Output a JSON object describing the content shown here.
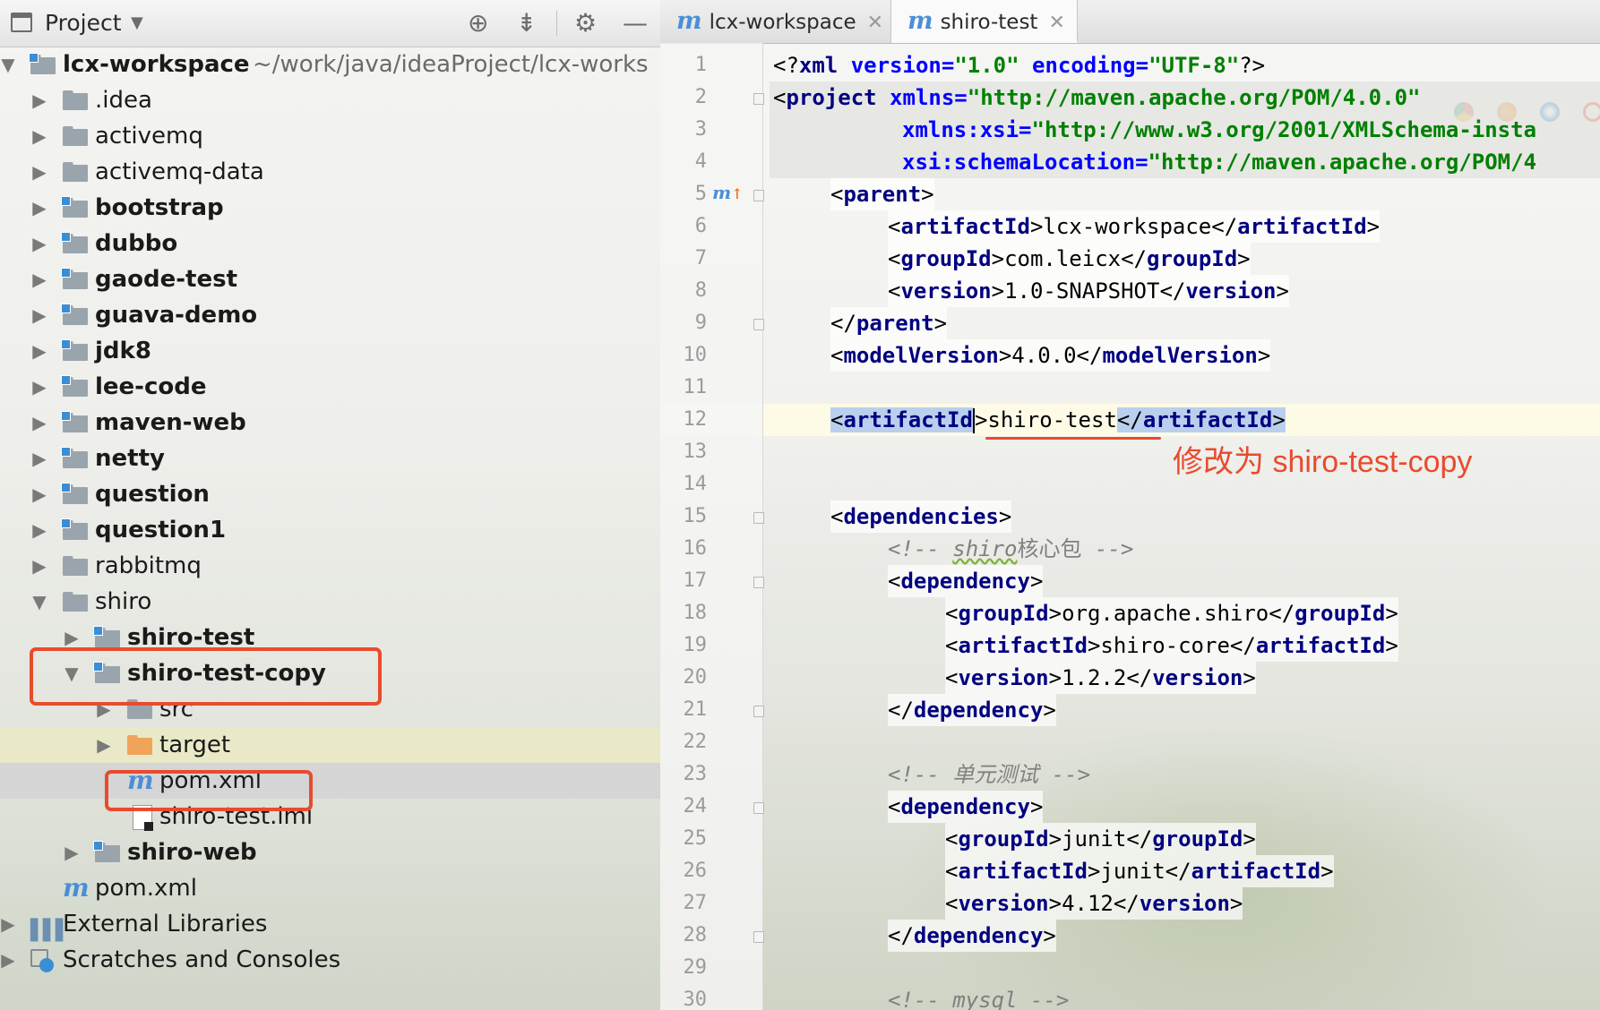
{
  "project_panel": {
    "title": "Project",
    "tree": [
      {
        "label": "lcx-workspace",
        "path": "~/work/java/ideaProject/lcx-works",
        "expanded": true,
        "bold": true
      },
      {
        "label": ".idea"
      },
      {
        "label": "activemq"
      },
      {
        "label": "activemq-data"
      },
      {
        "label": "bootstrap",
        "bold": true
      },
      {
        "label": "dubbo",
        "bold": true
      },
      {
        "label": "gaode-test",
        "bold": true
      },
      {
        "label": "guava-demo",
        "bold": true
      },
      {
        "label": "jdk8",
        "bold": true
      },
      {
        "label": "lee-code",
        "bold": true
      },
      {
        "label": "maven-web",
        "bold": true
      },
      {
        "label": "netty",
        "bold": true
      },
      {
        "label": "question",
        "bold": true
      },
      {
        "label": "question1",
        "bold": true
      },
      {
        "label": "rabbitmq"
      },
      {
        "label": "shiro",
        "expanded": true
      },
      {
        "label": "shiro-test",
        "bold": true
      },
      {
        "label": "shiro-test-copy",
        "bold": true,
        "expanded": true
      },
      {
        "label": "src"
      },
      {
        "label": "target"
      },
      {
        "label": "pom.xml"
      },
      {
        "label": "shiro-test.iml"
      },
      {
        "label": "shiro-web",
        "bold": true
      },
      {
        "label": "pom.xml"
      },
      {
        "label": "External Libraries"
      },
      {
        "label": "Scratches and Consoles"
      }
    ]
  },
  "editor": {
    "tabs": [
      {
        "label": "lcx-workspace",
        "active": false
      },
      {
        "label": "shiro-test",
        "active": true
      }
    ],
    "line_numbers": [
      "1",
      "2",
      "3",
      "4",
      "5",
      "6",
      "7",
      "8",
      "9",
      "10",
      "11",
      "12",
      "13",
      "14",
      "15",
      "16",
      "17",
      "18",
      "19",
      "20",
      "21",
      "22",
      "23",
      "24",
      "25",
      "26",
      "27",
      "28",
      "29",
      "30"
    ],
    "lines": {
      "l1": {
        "a": "<?",
        "b": "xml ",
        "c": "version",
        "d": "=",
        "e": "\"1.0\"",
        "f": " encoding",
        "g": "=",
        "h": "\"UTF-8\"",
        "i": "?>"
      },
      "l2": {
        "a": "<",
        "b": "project ",
        "c": "xmlns",
        "d": "=",
        "e": "\"http://maven.apache.org/POM/4.0.0\""
      },
      "l3": {
        "a": "xmlns:xsi",
        "b": "=",
        "c": "\"http://www.w3.org/2001/XMLSchema-insta"
      },
      "l4": {
        "a": "xsi:schemaLocation",
        "b": "=",
        "c": "\"http://maven.apache.org/POM/4"
      },
      "l5": {
        "a": "parent"
      },
      "l6": {
        "tag": "artifactId",
        "text": "lcx-workspace"
      },
      "l7": {
        "tag": "groupId",
        "text": "com.leicx"
      },
      "l8": {
        "tag": "version",
        "text": "1.0-SNAPSHOT"
      },
      "l9": {
        "a": "parent"
      },
      "l10": {
        "tag": "modelVersion",
        "text": "4.0.0"
      },
      "l12": {
        "tag": "artifactId",
        "text": "shiro-test"
      },
      "l15": {
        "a": "dependencies"
      },
      "l16": {
        "a": "<!-- ",
        "b": "shiro",
        "c": "核心包",
        "d": " -->"
      },
      "l17": {
        "a": "dependency"
      },
      "l18": {
        "tag": "groupId",
        "text": "org.apache.shiro"
      },
      "l19": {
        "tag": "artifactId",
        "text": "shiro-core"
      },
      "l20": {
        "tag": "version",
        "text": "1.2.2"
      },
      "l21": {
        "a": "dependency"
      },
      "l23": {
        "a": "<!-- 单元测试 -->"
      },
      "l24": {
        "a": "dependency"
      },
      "l25": {
        "tag": "groupId",
        "text": "junit"
      },
      "l26": {
        "tag": "artifactId",
        "text": "junit"
      },
      "l27": {
        "tag": "version",
        "text": "4.12"
      },
      "l28": {
        "a": "dependency"
      },
      "l30": {
        "a": "<!-- ",
        "b": "mysql",
        "c": " -->"
      }
    },
    "annotation": "修改为 shiro-test-copy"
  },
  "colors": {
    "annotation_red": "#e84b2d",
    "xml_tag": "#000080",
    "xml_attr": "#0000ff",
    "xml_value": "#008000",
    "comment": "#808080"
  }
}
